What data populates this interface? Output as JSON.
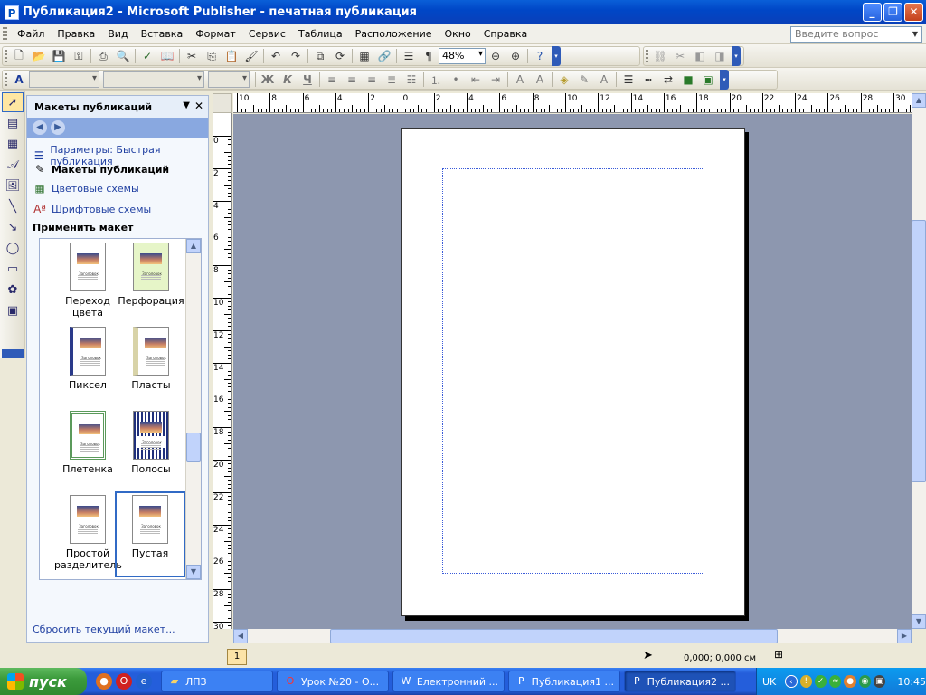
{
  "window": {
    "title": "Публикация2 - Microsoft Publisher - печатная публикация",
    "app_icon": "P",
    "controls": {
      "minimize": "_",
      "restore": "❐",
      "close": "✕"
    }
  },
  "menubar": {
    "items": [
      "Файл",
      "Правка",
      "Вид",
      "Вставка",
      "Формат",
      "Сервис",
      "Таблица",
      "Расположение",
      "Окно",
      "Справка"
    ],
    "help_placeholder": "Введите вопрос"
  },
  "standard_toolbar": {
    "zoom": "48%",
    "icons": [
      "new-icon",
      "open-icon",
      "save-icon",
      "print-icon",
      "print-preview-icon",
      "spelling-icon",
      "cut-icon",
      "copy-icon",
      "paste-icon",
      "format-painter-icon",
      "undo-icon",
      "redo-icon",
      "bring-front-icon",
      "send-back-icon",
      "insert-picture-icon",
      "columns-icon",
      "pilcrow-icon",
      "zoom-out-icon",
      "zoom-in-icon",
      "help-icon"
    ]
  },
  "formatting_toolbar": {
    "style_value": "",
    "font_value": "",
    "size_value": "",
    "bold": "Ж",
    "italic": "К",
    "underline": "Ч"
  },
  "task_pane": {
    "title": "Макеты публикаций",
    "links": [
      {
        "label": "Параметры: Быстрая публикация",
        "icon": "options-icon",
        "current": false
      },
      {
        "label": "Макеты публикаций",
        "icon": "layouts-icon",
        "current": true
      },
      {
        "label": "Цветовые схемы",
        "icon": "color-schemes-icon",
        "current": false
      },
      {
        "label": "Шрифтовые схемы",
        "icon": "font-schemes-icon",
        "current": false
      }
    ],
    "section_title": "Применить макет",
    "thumb_heading": "Заголовок",
    "layouts": [
      {
        "label": "Переход цвета",
        "selected": false
      },
      {
        "label": "Перфорация",
        "selected": false
      },
      {
        "label": "Пиксел",
        "selected": false
      },
      {
        "label": "Пласты",
        "selected": false
      },
      {
        "label": "Плетенка",
        "selected": false
      },
      {
        "label": "Полосы",
        "selected": false
      },
      {
        "label": "Простой разделитель",
        "selected": false
      },
      {
        "label": "Пустая",
        "selected": true
      }
    ],
    "reset_link": "Сбросить текущий макет..."
  },
  "rulers": {
    "horizontal": [
      "10",
      "8",
      "6",
      "4",
      "2",
      "0",
      "2",
      "4",
      "6",
      "8",
      "10",
      "12",
      "14",
      "16",
      "18",
      "20",
      "22",
      "24",
      "26",
      "28",
      "30"
    ],
    "vertical": [
      "0",
      "2",
      "4",
      "6",
      "8",
      "10",
      "12",
      "14",
      "16",
      "18",
      "20",
      "22",
      "24",
      "26",
      "28",
      "30"
    ]
  },
  "status": {
    "page_number": "1",
    "coordinates": "0,000; 0,000 см"
  },
  "taskbar": {
    "start_label": "пуск",
    "buttons": [
      {
        "label": "ЛПЗ",
        "icon": "folder-icon",
        "active": false
      },
      {
        "label": "Урок №20 - О...",
        "icon": "opera-icon",
        "active": false
      },
      {
        "label": "Електронний ...",
        "icon": "word-icon",
        "active": false
      },
      {
        "label": "Публикация1 ...",
        "icon": "publisher-icon",
        "active": false
      },
      {
        "label": "Публикация2 ...",
        "icon": "publisher-icon",
        "active": true
      }
    ],
    "language": "UK",
    "clock": "10:45"
  }
}
